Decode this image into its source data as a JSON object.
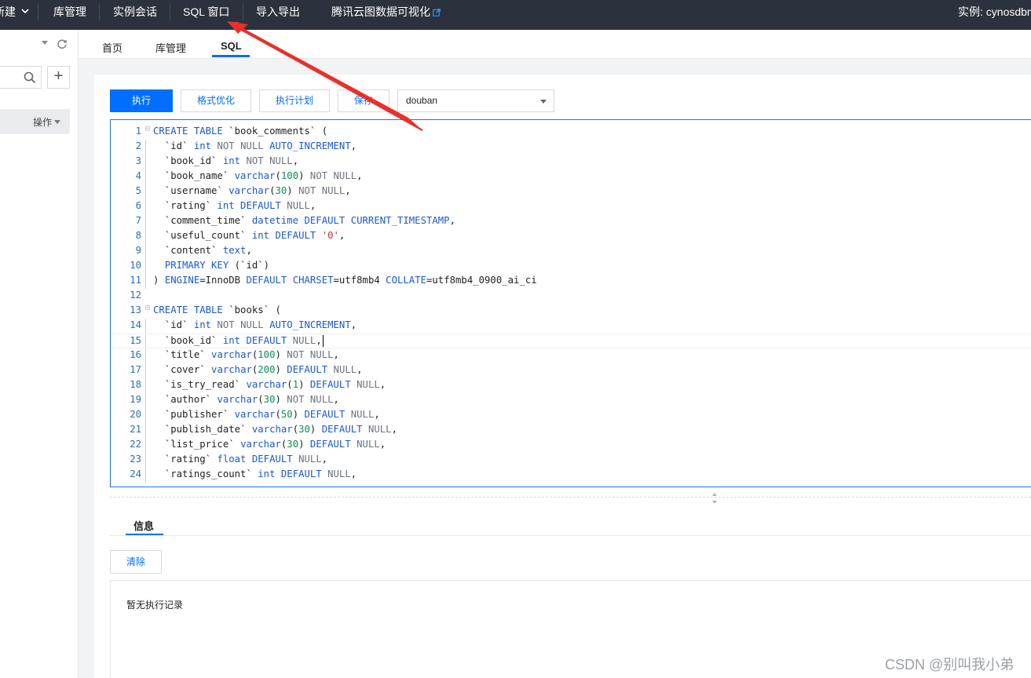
{
  "topbar": {
    "new_label": "新建",
    "menu": [
      "库管理",
      "实例会话",
      "SQL 窗口",
      "导入导出",
      "腾讯云图数据可视化"
    ],
    "instance_label": "实例: cynosdbm"
  },
  "sidebar": {
    "op_label": "操作"
  },
  "tabs": [
    "首页",
    "库管理",
    "SQL"
  ],
  "toolbar": {
    "execute": "执行",
    "format": "格式优化",
    "plan": "执行计划",
    "save": "保存",
    "database": "douban"
  },
  "editor": {
    "lines": [
      {
        "n": "1",
        "tokens": [
          [
            "k",
            "CREATE TABLE"
          ],
          [
            "p",
            " `book_comments` ("
          ]
        ]
      },
      {
        "n": "2",
        "tokens": [
          [
            "p",
            "  `id` "
          ],
          [
            "t",
            "int"
          ],
          [
            "g",
            " NOT NULL "
          ],
          [
            "k",
            "AUTO_INCREMENT"
          ],
          [
            "p",
            ","
          ]
        ]
      },
      {
        "n": "3",
        "tokens": [
          [
            "p",
            "  `book_id` "
          ],
          [
            "t",
            "int"
          ],
          [
            "g",
            " NOT NULL"
          ],
          [
            "p",
            ","
          ]
        ]
      },
      {
        "n": "4",
        "tokens": [
          [
            "p",
            "  `book_name` "
          ],
          [
            "t",
            "varchar"
          ],
          [
            "p",
            "("
          ],
          [
            "n",
            "100"
          ],
          [
            "p",
            ")"
          ],
          [
            "g",
            " NOT NULL"
          ],
          [
            "p",
            ","
          ]
        ]
      },
      {
        "n": "5",
        "tokens": [
          [
            "p",
            "  `username` "
          ],
          [
            "t",
            "varchar"
          ],
          [
            "p",
            "("
          ],
          [
            "n",
            "30"
          ],
          [
            "p",
            ")"
          ],
          [
            "g",
            " NOT NULL"
          ],
          [
            "p",
            ","
          ]
        ]
      },
      {
        "n": "6",
        "tokens": [
          [
            "p",
            "  `rating` "
          ],
          [
            "t",
            "int"
          ],
          [
            "k",
            " DEFAULT"
          ],
          [
            "g",
            " NULL"
          ],
          [
            "p",
            ","
          ]
        ]
      },
      {
        "n": "7",
        "tokens": [
          [
            "p",
            "  `comment_time` "
          ],
          [
            "t",
            "datetime"
          ],
          [
            "k",
            " DEFAULT CURRENT_TIMESTAMP"
          ],
          [
            "p",
            ","
          ]
        ]
      },
      {
        "n": "8",
        "tokens": [
          [
            "p",
            "  `useful_count` "
          ],
          [
            "t",
            "int"
          ],
          [
            "k",
            " DEFAULT "
          ],
          [
            "s",
            "'0'"
          ],
          [
            "p",
            ","
          ]
        ]
      },
      {
        "n": "9",
        "tokens": [
          [
            "p",
            "  `content` "
          ],
          [
            "t",
            "text"
          ],
          [
            "p",
            ","
          ]
        ]
      },
      {
        "n": "10",
        "tokens": [
          [
            "p",
            "  "
          ],
          [
            "k",
            "PRIMARY KEY"
          ],
          [
            "p",
            " (`id`)"
          ]
        ]
      },
      {
        "n": "11",
        "tokens": [
          [
            "p",
            ") "
          ],
          [
            "k",
            "ENGINE"
          ],
          [
            "p",
            "=InnoDB "
          ],
          [
            "k",
            "DEFAULT CHARSET"
          ],
          [
            "p",
            "=utf8mb4 "
          ],
          [
            "k",
            "COLLATE"
          ],
          [
            "p",
            "=utf8mb4_0900_ai_ci"
          ]
        ]
      },
      {
        "n": "12",
        "tokens": []
      },
      {
        "n": "13",
        "tokens": [
          [
            "k",
            "CREATE TABLE"
          ],
          [
            "p",
            " `books` ("
          ]
        ]
      },
      {
        "n": "14",
        "tokens": [
          [
            "p",
            "  `id` "
          ],
          [
            "t",
            "int"
          ],
          [
            "g",
            " NOT NULL "
          ],
          [
            "k",
            "AUTO_INCREMENT"
          ],
          [
            "p",
            ","
          ]
        ]
      },
      {
        "n": "15",
        "tokens": [
          [
            "p",
            "  `book_id` "
          ],
          [
            "t",
            "int"
          ],
          [
            "k",
            " DEFAULT"
          ],
          [
            "g",
            " NULL"
          ],
          [
            "p",
            ","
          ]
        ]
      },
      {
        "n": "16",
        "tokens": [
          [
            "p",
            "  `title` "
          ],
          [
            "t",
            "varchar"
          ],
          [
            "p",
            "("
          ],
          [
            "n",
            "100"
          ],
          [
            "p",
            ")"
          ],
          [
            "g",
            " NOT NULL"
          ],
          [
            "p",
            ","
          ]
        ]
      },
      {
        "n": "17",
        "tokens": [
          [
            "p",
            "  `cover` "
          ],
          [
            "t",
            "varchar"
          ],
          [
            "p",
            "("
          ],
          [
            "n",
            "200"
          ],
          [
            "p",
            ")"
          ],
          [
            "k",
            " DEFAULT"
          ],
          [
            "g",
            " NULL"
          ],
          [
            "p",
            ","
          ]
        ]
      },
      {
        "n": "18",
        "tokens": [
          [
            "p",
            "  `is_try_read` "
          ],
          [
            "t",
            "varchar"
          ],
          [
            "p",
            "("
          ],
          [
            "n",
            "1"
          ],
          [
            "p",
            ")"
          ],
          [
            "k",
            " DEFAULT"
          ],
          [
            "g",
            " NULL"
          ],
          [
            "p",
            ","
          ]
        ]
      },
      {
        "n": "19",
        "tokens": [
          [
            "p",
            "  `author` "
          ],
          [
            "t",
            "varchar"
          ],
          [
            "p",
            "("
          ],
          [
            "n",
            "30"
          ],
          [
            "p",
            ")"
          ],
          [
            "g",
            " NOT NULL"
          ],
          [
            "p",
            ","
          ]
        ]
      },
      {
        "n": "20",
        "tokens": [
          [
            "p",
            "  `publisher` "
          ],
          [
            "t",
            "varchar"
          ],
          [
            "p",
            "("
          ],
          [
            "n",
            "50"
          ],
          [
            "p",
            ")"
          ],
          [
            "k",
            " DEFAULT"
          ],
          [
            "g",
            " NULL"
          ],
          [
            "p",
            ","
          ]
        ]
      },
      {
        "n": "21",
        "tokens": [
          [
            "p",
            "  `publish_date` "
          ],
          [
            "t",
            "varchar"
          ],
          [
            "p",
            "("
          ],
          [
            "n",
            "30"
          ],
          [
            "p",
            ")"
          ],
          [
            "k",
            " DEFAULT"
          ],
          [
            "g",
            " NULL"
          ],
          [
            "p",
            ","
          ]
        ]
      },
      {
        "n": "22",
        "tokens": [
          [
            "p",
            "  `list_price` "
          ],
          [
            "t",
            "varchar"
          ],
          [
            "p",
            "("
          ],
          [
            "n",
            "30"
          ],
          [
            "p",
            ")"
          ],
          [
            "k",
            " DEFAULT"
          ],
          [
            "g",
            " NULL"
          ],
          [
            "p",
            ","
          ]
        ]
      },
      {
        "n": "23",
        "tokens": [
          [
            "p",
            "  `rating` "
          ],
          [
            "t",
            "float"
          ],
          [
            "k",
            " DEFAULT"
          ],
          [
            "g",
            " NULL"
          ],
          [
            "p",
            ","
          ]
        ]
      },
      {
        "n": "24",
        "tokens": [
          [
            "p",
            "  `ratings_count` "
          ],
          [
            "t",
            "int"
          ],
          [
            "k",
            " DEFAULT"
          ],
          [
            "g",
            " NULL"
          ],
          [
            "p",
            ","
          ]
        ]
      }
    ]
  },
  "info": {
    "tab_label": "信息",
    "clear": "清除",
    "empty_message": "暂无执行记录"
  },
  "watermark": "CSDN @别叫我小弟",
  "colors": {
    "topbar_bg": "#2b323d",
    "accent": "#006eff",
    "arrow": "#e8312a"
  }
}
